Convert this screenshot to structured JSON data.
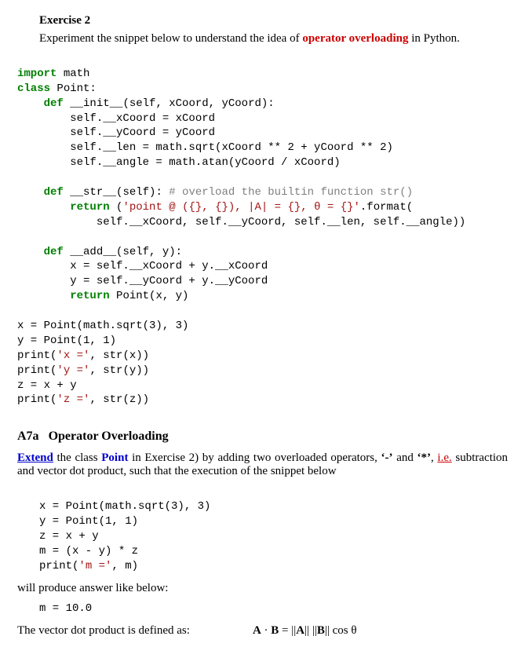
{
  "exercise2": {
    "heading": "Exercise 2",
    "intro_pre": "Experiment the snippet below to understand the idea of ",
    "intro_emph": "operator overloading",
    "intro_post": " in Python.",
    "code": {
      "l01a": "import",
      "l01b": " math",
      "l02a": "class",
      "l02b": " Point:",
      "l03a": "    ",
      "l03b": "def",
      "l03c": " __init__(self, xCoord, yCoord):",
      "l04": "        self.__xCoord = xCoord",
      "l05": "        self.__yCoord = yCoord",
      "l06": "        self.__len = math.sqrt(xCoord ** 2 + yCoord ** 2)",
      "l07": "        self.__angle = math.atan(yCoord / xCoord)",
      "l08a": "    ",
      "l08b": "def",
      "l08c": " __str__(self): ",
      "l08d": "# overload the builtin function str()",
      "l09a": "        ",
      "l09b": "return",
      "l09c": " (",
      "l09d": "'point @ ({}, {}), |A| = {}, θ = {}'",
      "l09e": ".format(",
      "l10": "            self.__xCoord, self.__yCoord, self.__len, self.__angle))",
      "l11a": "    ",
      "l11b": "def",
      "l11c": " __add__(self, y):",
      "l12": "        x = self.__xCoord + y.__xCoord",
      "l13": "        y = self.__yCoord + y.__yCoord",
      "l14a": "        ",
      "l14b": "return",
      "l14c": " Point(x, y)",
      "l15": "x = Point(math.sqrt(3), 3)",
      "l16": "y = Point(1, 1)",
      "l17a": "print(",
      "l17b": "'x ='",
      "l17c": ", str(x))",
      "l18a": "print(",
      "l18b": "'y ='",
      "l18c": ", str(y))",
      "l19": "z = x + y",
      "l20a": "print(",
      "l20b": "'z ='",
      "l20c": ", str(z))"
    }
  },
  "a7a": {
    "heading_num": "A7a",
    "heading_title": "Operator Overloading",
    "p1_extend": "Extend",
    "p1_a": " the class ",
    "p1_point": "Point",
    "p1_b": " in Exercise 2) by adding two overloaded operators, ",
    "p1_minus": "‘-’",
    "p1_c": " and ",
    "p1_star": "‘*’",
    "p1_d": ", ",
    "p1_ie": "i.e.",
    "p1_e": " subtraction and vector dot product, such that the execution of the snippet below",
    "code": {
      "c1": "x = Point(math.sqrt(3), 3)",
      "c2": "y = Point(1, 1)",
      "c3": "z = x + y",
      "c4": "m = (x - y) * z",
      "c5a": "print(",
      "c5b": "'m ='",
      "c5c": ", m)"
    },
    "p2": "will produce answer like below:",
    "output": "m = 10.0",
    "p3": "The vector dot product is defined as:",
    "formula": "A · B = ||A|| ||B|| cos θ"
  }
}
